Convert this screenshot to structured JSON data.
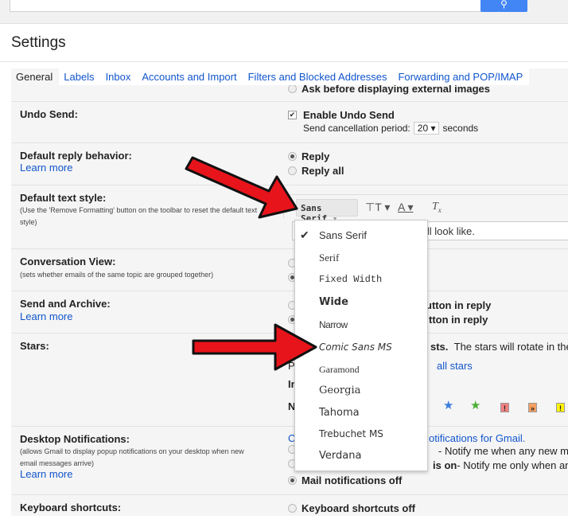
{
  "search": {
    "button_icon": "search-icon"
  },
  "header": {
    "title": "Settings"
  },
  "tabs": [
    {
      "label": "General"
    },
    {
      "label": "Labels"
    },
    {
      "label": "Inbox"
    },
    {
      "label": "Accounts and Import"
    },
    {
      "label": "Filters and Blocked Addresses"
    },
    {
      "label": "Forwarding and POP/IMAP"
    }
  ],
  "images": {
    "option": "Ask before displaying external images"
  },
  "undo": {
    "label": "Undo Send:",
    "option": "Enable Undo Send",
    "period_label": "Send cancellation period:",
    "period_value": "20",
    "period_unit": "seconds"
  },
  "reply": {
    "label": "Default reply behavior:",
    "learn": "Learn more",
    "opt1": "Reply",
    "opt2": "Reply all"
  },
  "textstyle": {
    "label": "Default text style:",
    "sub": "(Use the 'Remove Formatting' button on the toolbar to reset the default text style)",
    "font": "Sans Serif",
    "preview": "ill look like."
  },
  "font_menu": [
    "Sans Serif",
    "Serif",
    "Fixed Width",
    "Wide",
    "Narrow",
    "Comic Sans MS",
    "Garamond",
    "Georgia",
    "Tahoma",
    "Trebuchet MS",
    "Verdana"
  ],
  "conversation": {
    "label": "Conversation View:",
    "sub": "(sets whether emails of the same topic are grouped together)"
  },
  "sendarchive": {
    "label": "Send and Archive:",
    "learn": "Learn more",
    "opt1": "utton in reply",
    "opt2": "tton in reply"
  },
  "stars": {
    "label": "Stars:",
    "text": "sts.",
    "text2": "The stars will rotate in the",
    "link": "all stars",
    "p": "P",
    "in": "In",
    "n": "N"
  },
  "desktop": {
    "label": "Desktop Notifications:",
    "sub": "(allows Gmail to display popup notifications on your desktop when new email messages arrive)",
    "learn": "Learn more",
    "c": "C",
    "link": "otifications for Gmail.",
    "opt1": "- Notify me when any new mes",
    "opt2b": "is on",
    "opt2": " - Notify me only when an",
    "opt3": "Mail notifications off"
  },
  "keyboard": {
    "label": "Keyboard shortcuts:",
    "opt": "Keyboard shortcuts off"
  },
  "colors": {
    "accent": "#4285f4",
    "link": "#1155cc",
    "arrow": "#e8141b"
  }
}
